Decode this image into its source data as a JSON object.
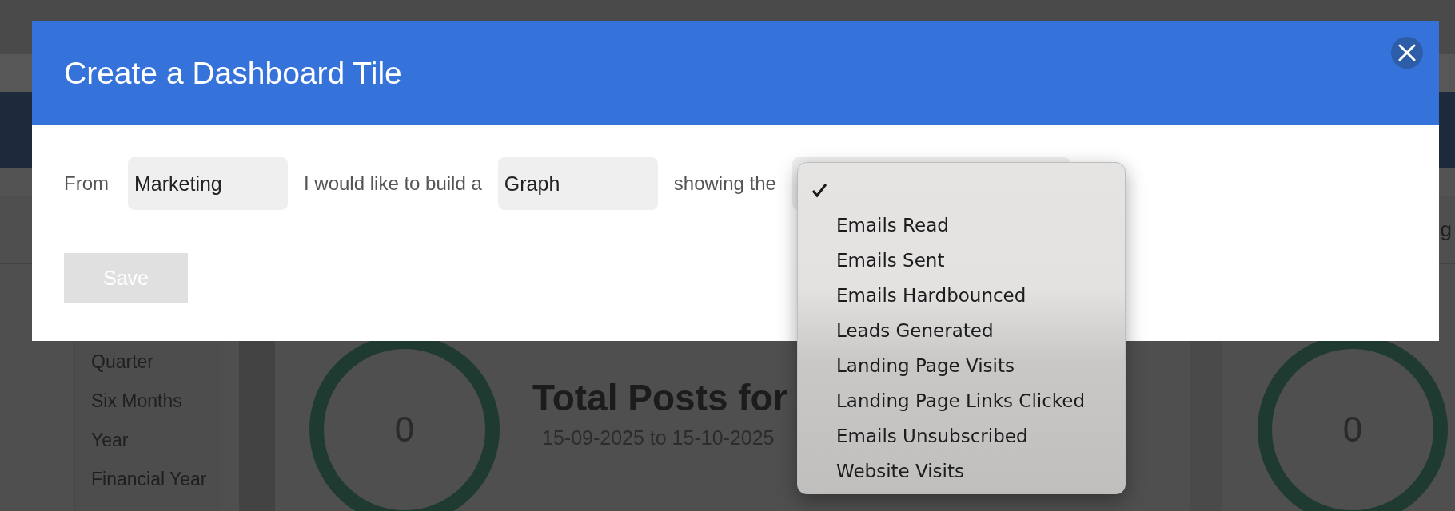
{
  "background": {
    "toolbar_fragment": "g",
    "period_options": [
      "Quarter",
      "Six Months",
      "Year",
      "Financial Year"
    ],
    "tiles": [
      {
        "value": "0",
        "title": "Total Posts for",
        "date_range": "15-09-2025 to 15-10-2025"
      },
      {
        "value": "0"
      }
    ]
  },
  "modal": {
    "title": "Create a Dashboard Tile",
    "sentence": [
      {
        "kind": "label",
        "text": "From"
      },
      {
        "kind": "select",
        "value": "Marketing"
      },
      {
        "kind": "label",
        "text": "I would like to build a"
      },
      {
        "kind": "select",
        "value": "Graph"
      },
      {
        "kind": "label",
        "text": "showing the"
      },
      {
        "kind": "select"
      }
    ],
    "save_button": {
      "label": "Save",
      "disabled": true
    }
  },
  "dropdown": {
    "items": [
      {
        "kind": "blank",
        "selected": true
      },
      {
        "kind": "option",
        "label": "Emails Read",
        "selected": false
      },
      {
        "kind": "option",
        "label": "Emails Sent",
        "selected": false
      },
      {
        "kind": "option",
        "label": "Emails Hardbounced",
        "selected": false
      },
      {
        "kind": "option",
        "label": "Leads Generated",
        "selected": false
      },
      {
        "kind": "option",
        "label": "Landing Page Visits",
        "selected": false
      },
      {
        "kind": "option",
        "label": "Landing Page Links Clicked",
        "selected": false
      },
      {
        "kind": "option",
        "label": "Emails Unsubscribed",
        "selected": false
      },
      {
        "kind": "option",
        "label": "Website Visits",
        "selected": false
      }
    ]
  }
}
